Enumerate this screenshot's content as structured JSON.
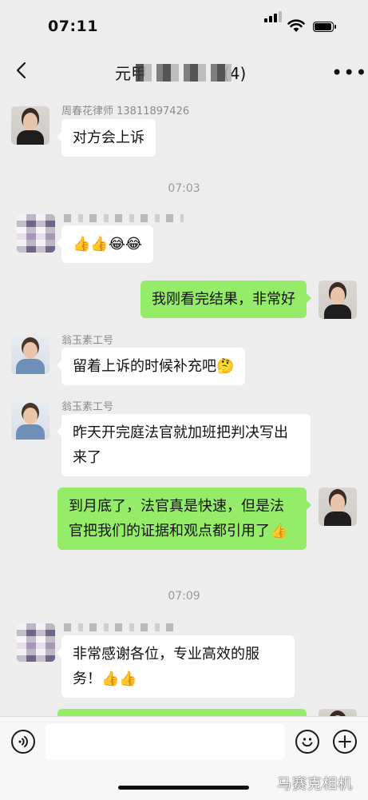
{
  "status_bar": {
    "time": "07:11"
  },
  "nav": {
    "title": "元甲",
    "count": "(4)"
  },
  "messages": {
    "m1": {
      "sender": "周春花律师 13811897426",
      "text": "对方会上诉"
    },
    "ts1": "07:03",
    "m2": {
      "text": "👍👍😂😂"
    },
    "m3": {
      "text": "我刚看完结果，非常好"
    },
    "m4": {
      "sender": "翁玉素工号",
      "text": "留着上诉的时候补充吧🤔"
    },
    "m5": {
      "sender": "翁玉素工号",
      "text": "昨天开完庭法官就加班把判决写出来了"
    },
    "m6": {
      "text": "到月底了，法官真是快速，但是法官把我们的证据和观点都引用了👍"
    },
    "ts2": "07:09",
    "m7": {
      "text": "非常感谢各位，专业高效的服务！👍👍"
    }
  },
  "watermark": "马赛克相机",
  "icons": [
    "back-icon",
    "more-icon",
    "voice-icon",
    "emoji-icon",
    "plus-icon"
  ]
}
